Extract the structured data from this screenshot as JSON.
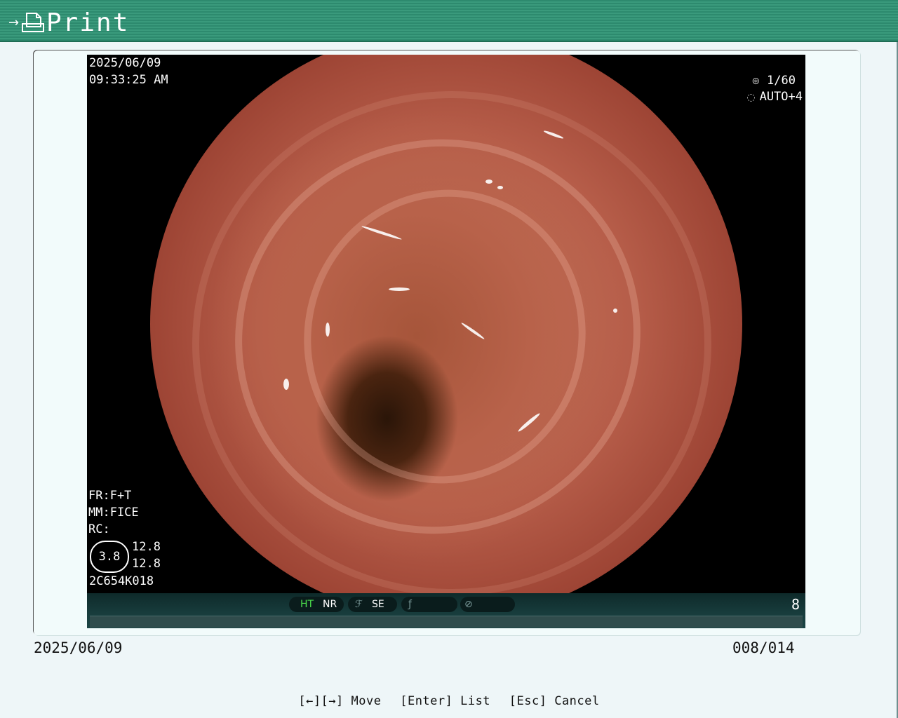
{
  "header": {
    "title": "Print",
    "icon": "print-icon"
  },
  "image": {
    "overlay": {
      "date": "2025/06/09",
      "time": "09:33:25  AM",
      "shutter": "1/60",
      "auto": "AUTO+4",
      "fr": "FR:F+T",
      "mm": "MM:FICE",
      "rc": "RC:",
      "oval_value": "3.8",
      "side_value_1": "12.8",
      "side_value_2": "12.8",
      "scope_id": "2C654K018"
    },
    "status": {
      "ht": "HT",
      "nr": "NR",
      "se": "SE",
      "page": "8"
    }
  },
  "footer": {
    "date": "2025/06/09",
    "count": "008/014",
    "help": [
      "[←][→] Move",
      "[Enter] List",
      "[Esc] Cancel"
    ]
  },
  "colors": {
    "header": "#2d8a6e",
    "background": "#eef6f8",
    "ht": "#4ce04c"
  }
}
